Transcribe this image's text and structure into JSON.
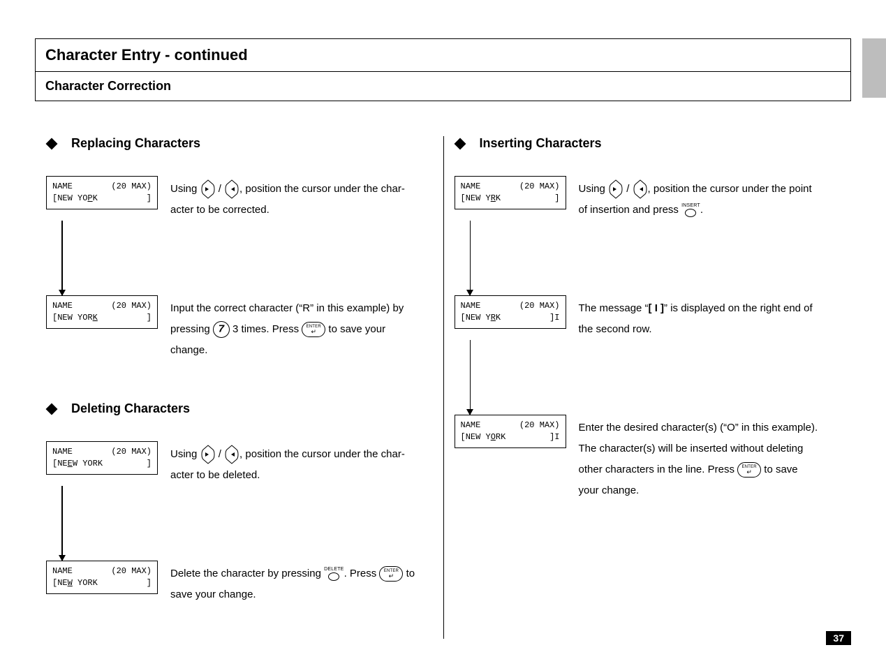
{
  "page_number": "37",
  "title": "Character Entry - continued",
  "subtitle": "Character Correction",
  "left_col": {
    "replacing": {
      "heading": "Replacing Characters",
      "lcd1": {
        "l1_left": "NAME",
        "l1_right": "(20 MAX)",
        "l2_pre": "[NEW YO",
        "l2_u": "P",
        "l2_post": "K",
        "l2_end": "]"
      },
      "desc1_a": "Using ",
      "desc1_b": ", position the cursor under the char-",
      "desc1_c": "acter to be corrected.",
      "lcd2": {
        "l1_left": "NAME",
        "l1_right": "(20 MAX)",
        "l2_pre": "[NEW YOR",
        "l2_u": "K",
        "l2_post": "",
        "l2_end": "]"
      },
      "desc2_a": "Input the correct character (“R” in this example) by",
      "desc2_b": "pressing ",
      "desc2_c": " 3 times. Press ",
      "desc2_d": " to save your",
      "desc2_e": "change.",
      "key_7": "7",
      "enter_label": "ENTER"
    },
    "deleting": {
      "heading": "Deleting Characters",
      "lcd1": {
        "l1_left": "NAME",
        "l1_right": "(20 MAX)",
        "l2_pre": "[NE",
        "l2_u": "E",
        "l2_post": "W YORK",
        "l2_end": "]"
      },
      "desc1_a": "Using ",
      "desc1_b": ", position the cursor under the char-",
      "desc1_c": "acter to be deleted.",
      "lcd2": {
        "l1_left": "NAME",
        "l1_right": "(20 MAX)",
        "l2_pre": "[NE",
        "l2_u": "W",
        "l2_post": " YORK",
        "l2_end": "]"
      },
      "desc2_a": "Delete the character by pressing ",
      "desc2_b": ". Press ",
      "desc2_c": " to",
      "desc2_d": "save your change.",
      "delete_label": "DELETE",
      "enter_label": "ENTER"
    }
  },
  "right_col": {
    "inserting": {
      "heading": "Inserting Characters",
      "lcd1": {
        "l1_left": "NAME",
        "l1_right": "(20 MAX)",
        "l2_pre": "[NEW Y",
        "l2_u": "R",
        "l2_post": "K",
        "l2_end": "]"
      },
      "desc1_a": "Using ",
      "desc1_b": ", position the cursor under the point",
      "desc1_c": "of insertion and press ",
      "desc1_d": ".",
      "insert_label": "INSERT",
      "lcd2": {
        "l1_left": "NAME",
        "l1_right": "(20 MAX)",
        "l2_pre": "[NEW Y",
        "l2_u": "R",
        "l2_post": "K",
        "l2_end": "]I"
      },
      "desc2_a": "The message “",
      "desc2_b": "[ I ]",
      "desc2_c": "” is displayed on the right end of",
      "desc2_d": "the second row.",
      "lcd3": {
        "l1_left": "NAME",
        "l1_right": "(20 MAX)",
        "l2_pre": "[NEW Y",
        "l2_u": "O",
        "l2_post": "RK",
        "l2_end": "]I"
      },
      "desc3_a": "Enter the desired character(s) (“O” in this example).",
      "desc3_b": "The character(s) will be inserted without deleting",
      "desc3_c": "other characters in the line. Press ",
      "desc3_d": " to save",
      "desc3_e": "your change.",
      "enter_label": "ENTER"
    }
  },
  "nav_slash": " / "
}
